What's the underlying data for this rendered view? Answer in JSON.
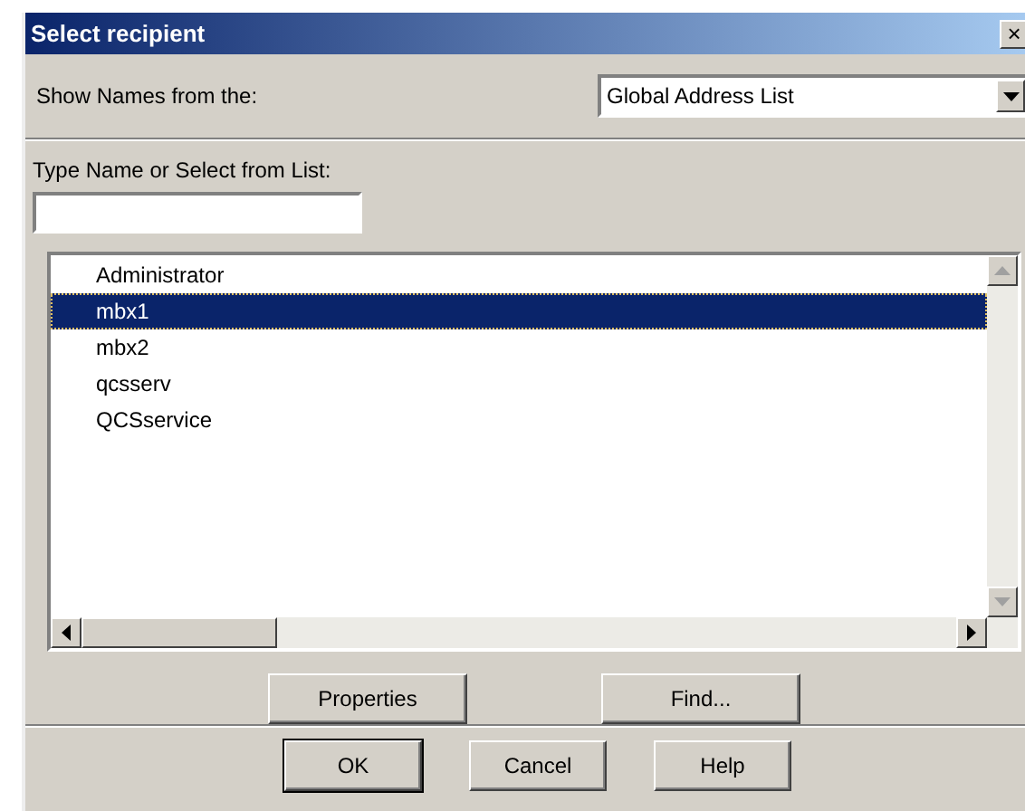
{
  "window": {
    "title": "Select recipient",
    "close_button": "×"
  },
  "show_names": {
    "label": "Show Names from the:",
    "value": "Global Address List"
  },
  "type_name": {
    "label": "Type Name or Select from List:"
  },
  "list": [
    {
      "name": "Administrator",
      "selected": false
    },
    {
      "name": "mbx1",
      "selected": true
    },
    {
      "name": "mbx2",
      "selected": false
    },
    {
      "name": "qcsserv",
      "selected": false
    },
    {
      "name": "QCSservice",
      "selected": false
    }
  ],
  "action_buttons": [
    "Properties",
    "Find..."
  ],
  "dialog_buttons": [
    {
      "label": "OK",
      "default": true
    },
    {
      "label": "Cancel",
      "default": false
    },
    {
      "label": "Help",
      "default": false
    }
  ]
}
